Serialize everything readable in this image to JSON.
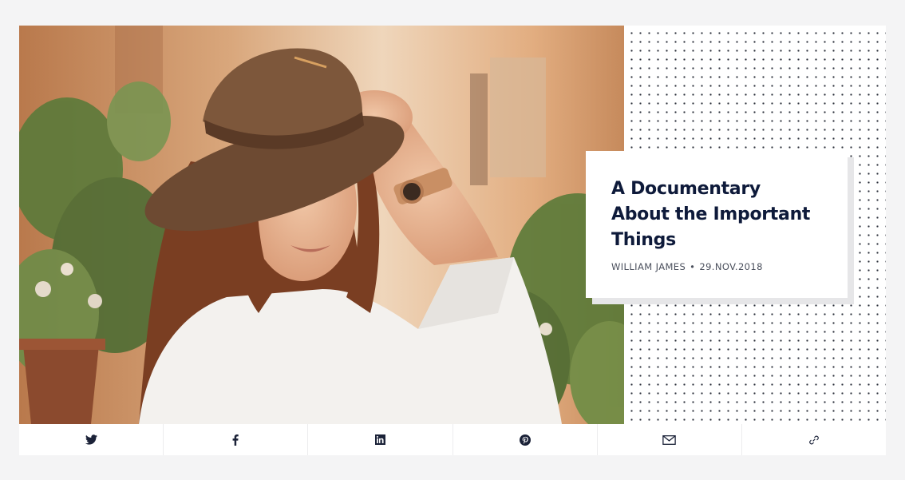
{
  "post": {
    "title": "A Documentary About the Important Things",
    "author": "WILLIAM JAMES",
    "separator": "•",
    "date": "29.NOV.2018"
  },
  "hero_image": {
    "subject": "woman in brown hat with wooden wristwatch"
  },
  "share": {
    "items": [
      {
        "name": "twitter",
        "icon": "twitter-icon"
      },
      {
        "name": "facebook",
        "icon": "facebook-icon"
      },
      {
        "name": "linkedin",
        "icon": "linkedin-icon"
      },
      {
        "name": "pinterest",
        "icon": "pinterest-icon"
      },
      {
        "name": "email",
        "icon": "envelope-icon"
      },
      {
        "name": "link",
        "icon": "link-icon"
      }
    ]
  },
  "colors": {
    "title": "#0e1a3a",
    "meta": "#4a4f5c",
    "background": "#f4f4f5",
    "icon": "#1b2238"
  }
}
